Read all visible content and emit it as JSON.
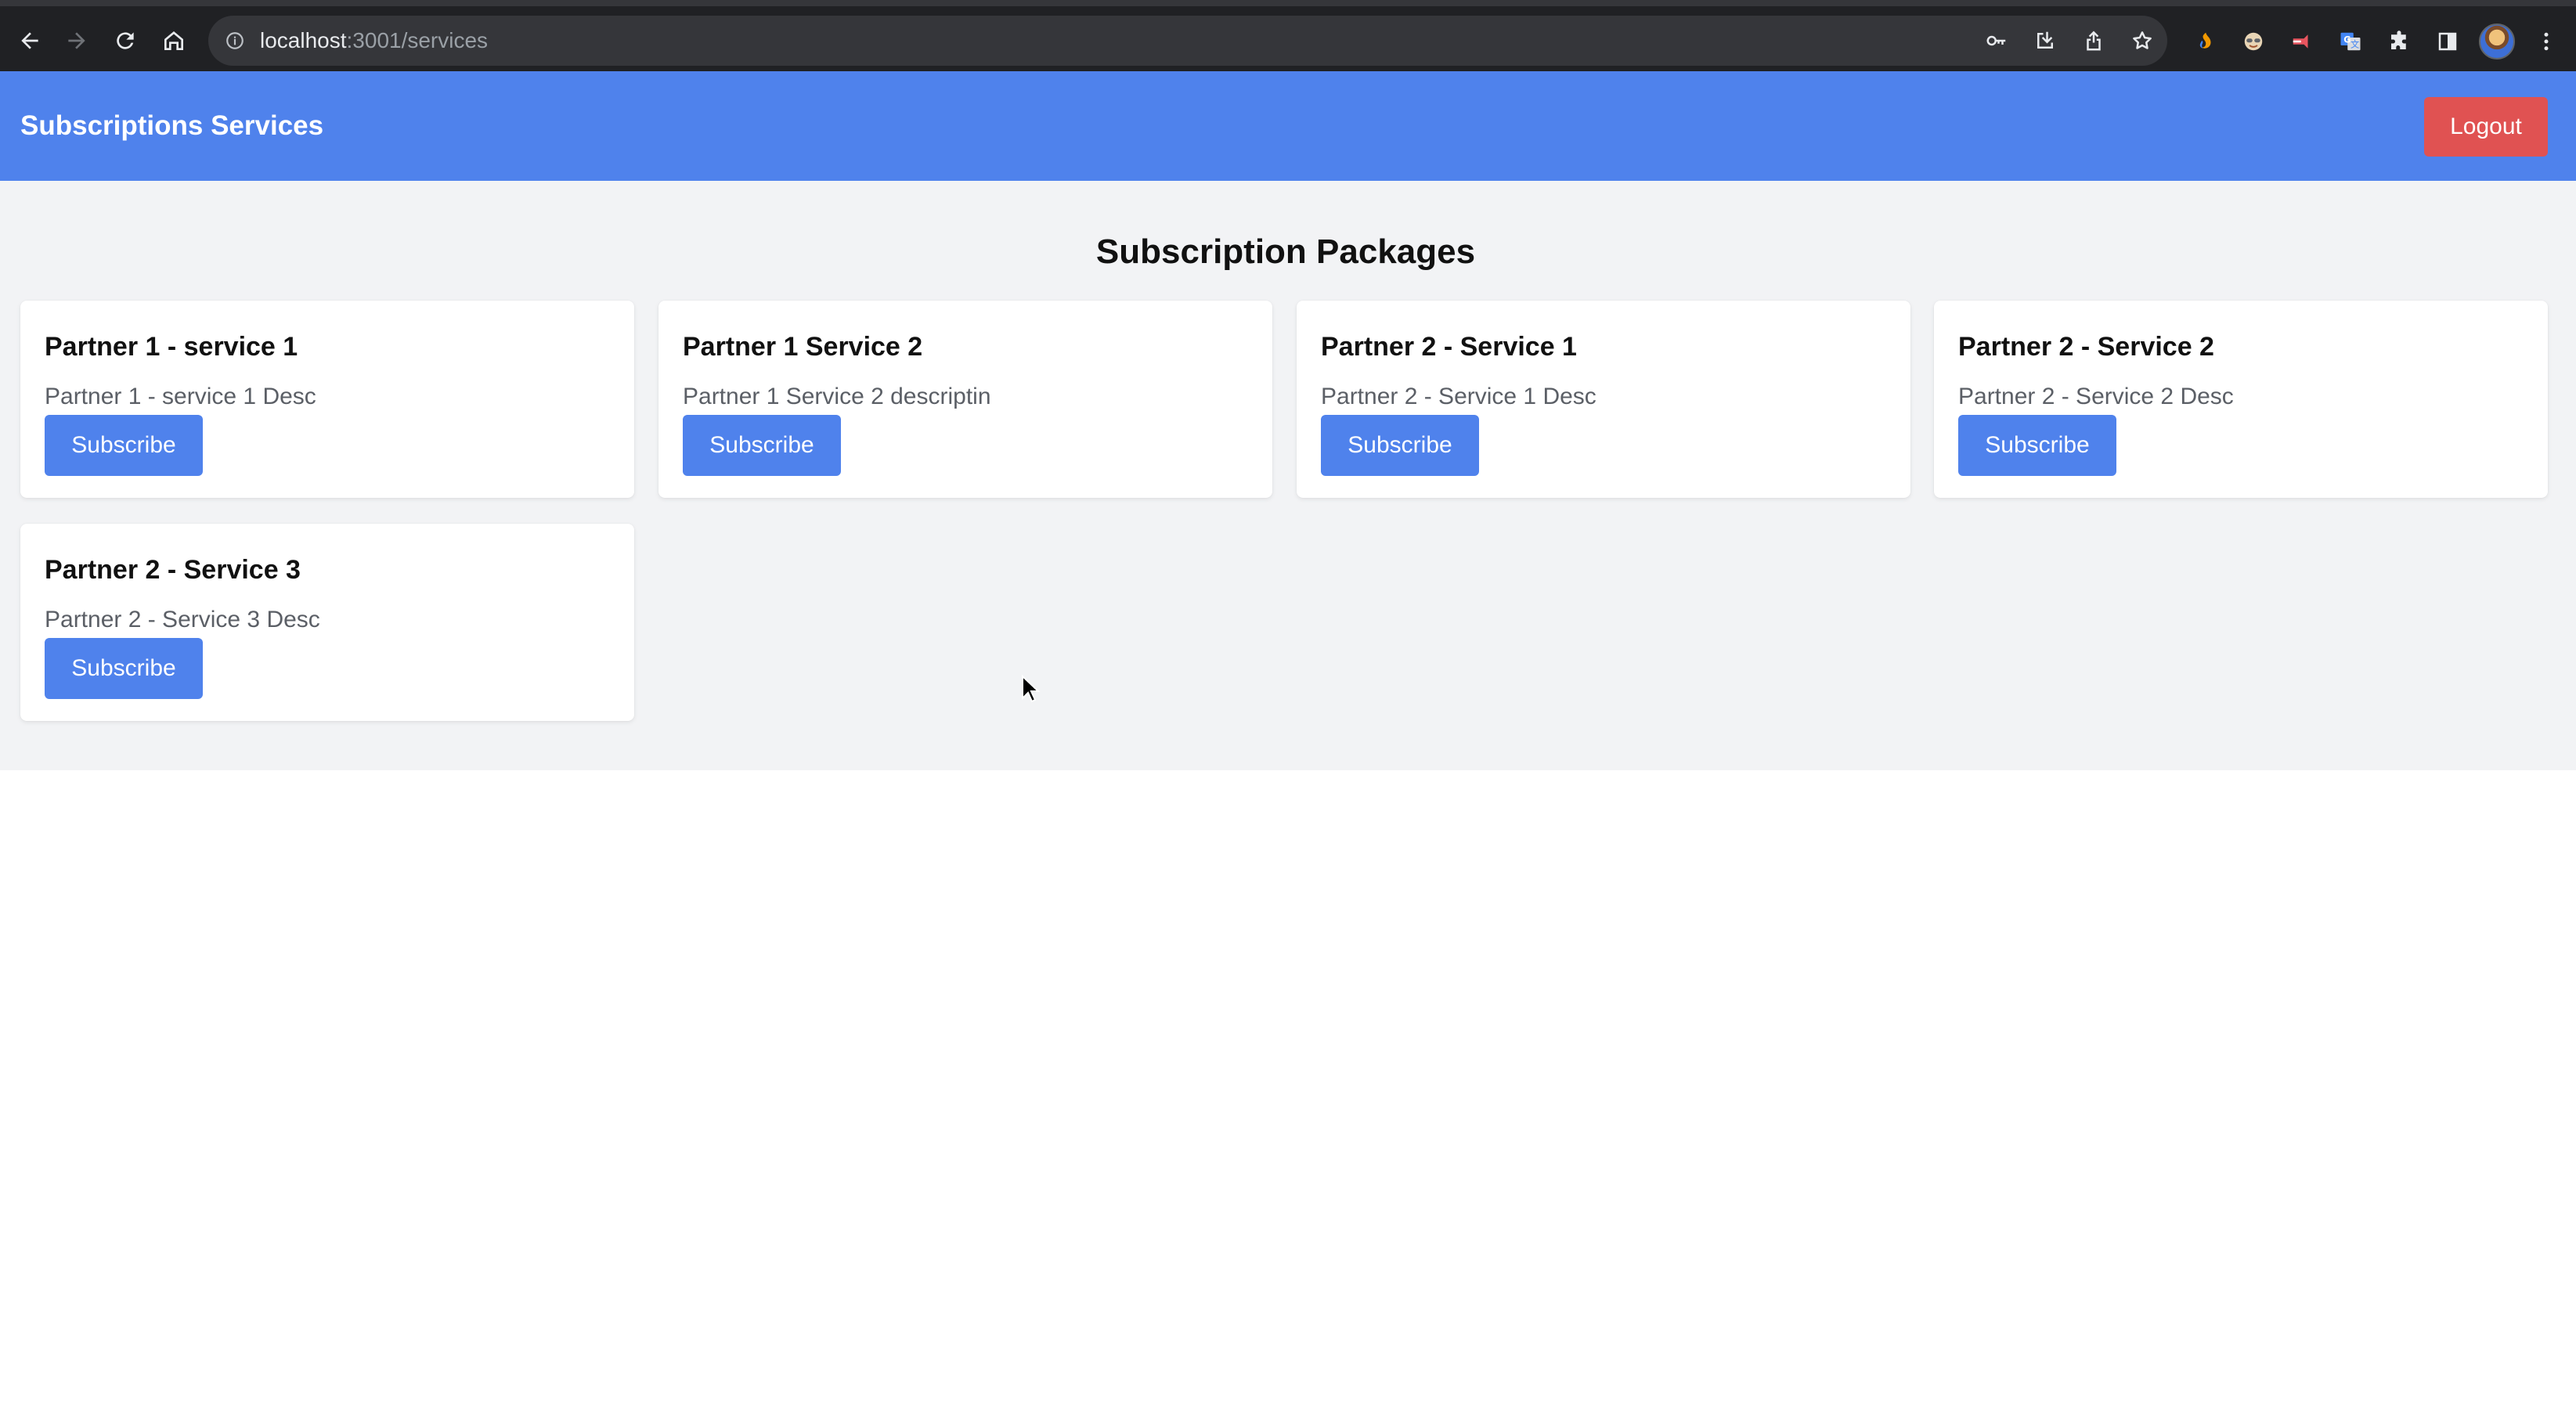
{
  "browser": {
    "url_host": "localhost",
    "url_path": ":3001/services",
    "nav_icons": [
      "back-icon",
      "forward-icon",
      "reload-icon",
      "home-icon",
      "info-icon"
    ],
    "toolbar_icons": [
      "key-icon",
      "install-icon",
      "share-icon",
      "star-icon"
    ],
    "extension_icons": [
      "extension-flame-icon",
      "extension-face-icon",
      "extension-red-icon",
      "google-translate-icon",
      "puzzle-icon",
      "side-panel-icon",
      "avatar",
      "more-icon"
    ]
  },
  "header": {
    "brand": "Subscriptions Services",
    "logout_label": "Logout",
    "color": "#4f82ec",
    "logout_color": "#e05252"
  },
  "main": {
    "title": "Subscription Packages",
    "cards": [
      {
        "title": "Partner 1 - service 1",
        "description": "Partner 1 - service 1 Desc",
        "button": "Subscribe"
      },
      {
        "title": "Partner 1 Service 2",
        "description": "Partner 1 Service 2 descriptin",
        "button": "Subscribe"
      },
      {
        "title": "Partner 2 - Service 1",
        "description": "Partner 2 - Service 1 Desc",
        "button": "Subscribe"
      },
      {
        "title": "Partner 2 - Service 2",
        "description": "Partner 2 - Service 2 Desc",
        "button": "Subscribe"
      },
      {
        "title": "Partner 2 - Service 3",
        "description": "Partner 2 - Service 3 Desc",
        "button": "Subscribe"
      }
    ]
  }
}
